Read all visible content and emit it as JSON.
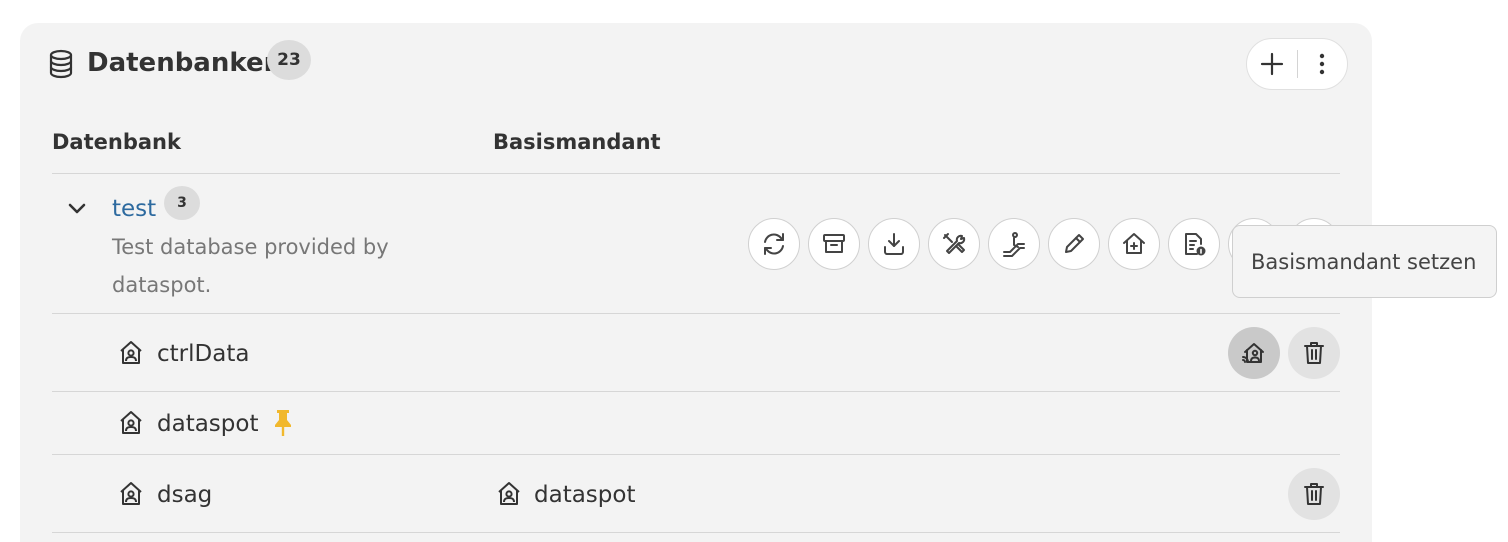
{
  "panel": {
    "title": "Datenbanken",
    "count": "23",
    "header_icon": "database-icon",
    "actions": [
      {
        "name": "add",
        "icon": "plus-icon"
      },
      {
        "name": "more",
        "icon": "kebab-menu-icon"
      }
    ]
  },
  "table": {
    "columns": [
      "Datenbank",
      "Basismandant"
    ]
  },
  "database": {
    "name": "test",
    "count": "3",
    "description": "Test database provided by dataspot.",
    "action_icons": [
      "sync-icon",
      "archive-icon",
      "download-icon",
      "tools-icon",
      "escalator-icon",
      "pencil-icon",
      "home-plus-icon",
      "document-info-icon"
    ]
  },
  "tooltip": {
    "text": "Basismandant setzen"
  },
  "tenants": [
    {
      "name": "ctrlData",
      "basis": "",
      "pinned": false,
      "actions": [
        "set-basis-tenant-icon",
        "trash-icon"
      ]
    },
    {
      "name": "dataspot",
      "basis": "",
      "pinned": true,
      "actions": []
    },
    {
      "name": "dsag",
      "basis": "dataspot",
      "pinned": false,
      "actions": [
        "trash-icon"
      ]
    }
  ],
  "colors": {
    "panel_bg": "#f3f3f3",
    "link": "#2d6a9f",
    "pin": "#f1b82d",
    "hover_btn": "#c9c9c9",
    "action_btn": "#e2e2e2"
  }
}
